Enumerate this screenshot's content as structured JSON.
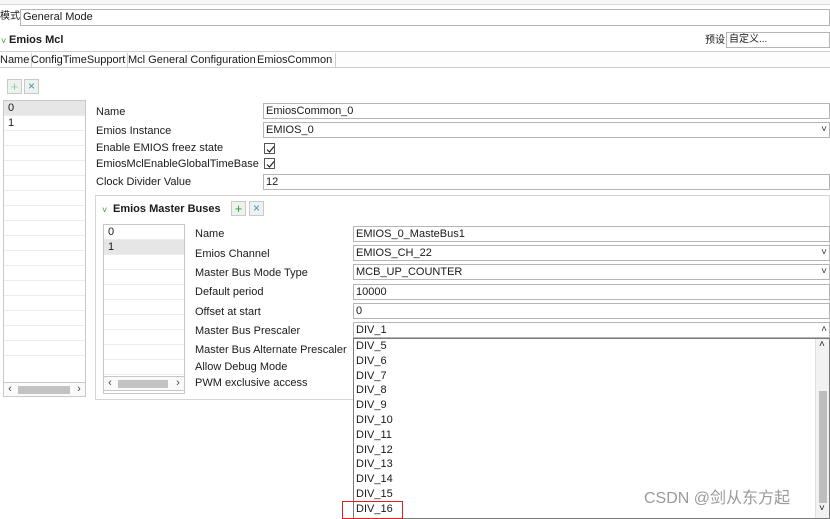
{
  "top": {
    "mode_label": "模式",
    "mode_value": "General Mode"
  },
  "section": {
    "title": "Emios Mcl",
    "preset_label": "预设",
    "preset_value": "自定义..."
  },
  "tabs": [
    "Name",
    "ConfigTimeSupport",
    "Mcl General Configuration",
    "EmiosCommon"
  ],
  "toolbar": {
    "add": "+",
    "remove": "×"
  },
  "left_list": [
    "0",
    "1"
  ],
  "common": {
    "name_label": "Name",
    "name_value": "EmiosCommon_0",
    "instance_label": "Emios Instance",
    "instance_value": "EMIOS_0",
    "freeze_label": "Enable EMIOS freez state",
    "freeze_checked": true,
    "global_tb_label": "EmiosMclEnableGlobalTimeBase",
    "global_tb_checked": true,
    "clock_div_label": "Clock Divider Value",
    "clock_div_value": "12"
  },
  "master": {
    "title": "Emios Master Buses",
    "list": [
      "0",
      "1"
    ],
    "name_label": "Name",
    "name_value": "EMIOS_0_MasteBus1",
    "channel_label": "Emios Channel",
    "channel_value": "EMIOS_CH_22",
    "mode_label": "Master Bus Mode Type",
    "mode_value": "MCB_UP_COUNTER",
    "period_label": "Default period",
    "period_value": "10000",
    "offset_label": "Offset at start",
    "offset_value": "0",
    "prescaler_label": "Master Bus Prescaler",
    "prescaler_value": "DIV_1",
    "alt_prescaler_label": "Master Bus Alternate Prescaler",
    "debug_label": "Allow Debug Mode",
    "pwm_label": "PWM exclusive access"
  },
  "dropdown_options": [
    "DIV_5",
    "DIV_6",
    "DIV_7",
    "DIV_8",
    "DIV_9",
    "DIV_10",
    "DIV_11",
    "DIV_12",
    "DIV_13",
    "DIV_14",
    "DIV_15",
    "DIV_16"
  ],
  "highlighted_option": "DIV_16",
  "watermark": "CSDN @剑从东方起",
  "colors": {
    "highlight_border": "#e02020",
    "accent_green": "#3a9a3a"
  }
}
